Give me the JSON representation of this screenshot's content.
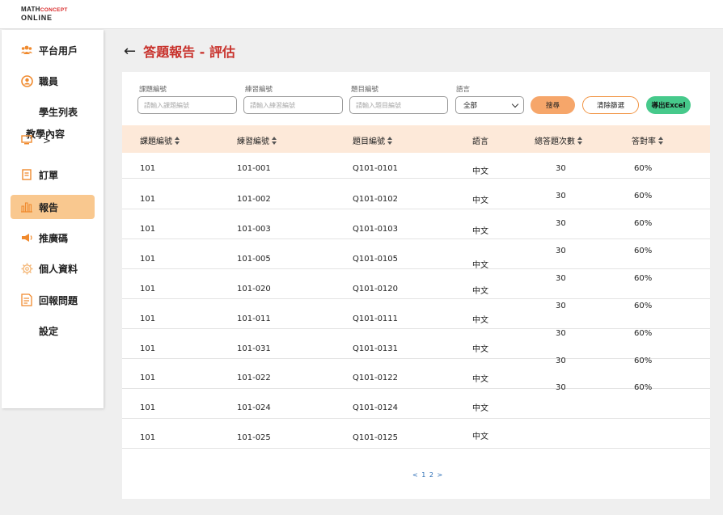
{
  "logo": {
    "line1_a": "MATH",
    "line1_b": "CONCEPT",
    "line2": "ONLINE"
  },
  "sidebar": {
    "items": [
      {
        "label": "平台用戶",
        "icon": "users-icon",
        "active": false
      },
      {
        "label": "職員",
        "icon": "user-circle-icon",
        "active": false
      },
      {
        "label": "學生列表",
        "icon": "",
        "active": false
      },
      {
        "label": "教學內容",
        "icon": "monitor-icon",
        "chevron": ">",
        "active": false
      },
      {
        "label": "訂單",
        "icon": "order-icon",
        "active": false
      },
      {
        "label": "報告",
        "icon": "bar-chart-icon",
        "active": true
      },
      {
        "label": "推廣碼",
        "icon": "megaphone-icon",
        "active": false
      },
      {
        "label": "個人資料",
        "icon": "gear-icon",
        "active": false
      },
      {
        "label": "回報問題",
        "icon": "report-icon",
        "active": false
      },
      {
        "label": "設定",
        "icon": "",
        "active": false
      }
    ]
  },
  "header": {
    "back": "←",
    "title": "答題報告 - 評估"
  },
  "filters": {
    "lesson": {
      "label": "課題編號",
      "placeholder": "請輸入課題編號"
    },
    "exercise": {
      "label": "練習編號",
      "placeholder": "請輸入練習編號"
    },
    "question": {
      "label": "題目編號",
      "placeholder": "請輸入題目編號"
    },
    "language": {
      "label": "語言",
      "value": "全部"
    },
    "search_label": "搜尋",
    "clear_label": "清除篩選",
    "export_label": "導出Excel"
  },
  "table": {
    "columns": [
      "課題編號",
      "練習編號",
      "題目編號",
      "語言",
      "總答題次數",
      "答對率"
    ],
    "rows": [
      {
        "lesson": "101",
        "exercise": "101-001",
        "question": "Q101-0101",
        "lang": "中文",
        "count": "30",
        "rate": "60%"
      },
      {
        "lesson": "101",
        "exercise": "101-002",
        "question": "Q101-0102",
        "lang": "中文",
        "count": "30",
        "rate": "60%"
      },
      {
        "lesson": "101",
        "exercise": "101-003",
        "question": "Q101-0103",
        "lang": "中文",
        "count": "30",
        "rate": "60%"
      },
      {
        "lesson": "101",
        "exercise": "101-005",
        "question": "Q101-0105",
        "lang": "中文",
        "count": "30",
        "rate": "60%"
      },
      {
        "lesson": "101",
        "exercise": "101-020",
        "question": "Q101-0120",
        "lang": "中文",
        "count": "30",
        "rate": "60%"
      },
      {
        "lesson": "101",
        "exercise": "101-011",
        "question": "Q101-0111",
        "lang": "中文",
        "count": "30",
        "rate": "60%"
      },
      {
        "lesson": "101",
        "exercise": "101-031",
        "question": "Q101-0131",
        "lang": "中文",
        "count": "30",
        "rate": "60%"
      },
      {
        "lesson": "101",
        "exercise": "101-022",
        "question": "Q101-0122",
        "lang": "中文",
        "count": "30",
        "rate": "60%"
      },
      {
        "lesson": "101",
        "exercise": "101-024",
        "question": "Q101-0124",
        "lang": "中文",
        "count": "30",
        "rate": "60%"
      },
      {
        "lesson": "101",
        "exercise": "101-025",
        "question": "Q101-0125",
        "lang": "中文",
        "count": "",
        "rate": ""
      }
    ]
  },
  "pagination": {
    "prev": "<",
    "pages": [
      "1",
      "2"
    ],
    "next": ">"
  }
}
